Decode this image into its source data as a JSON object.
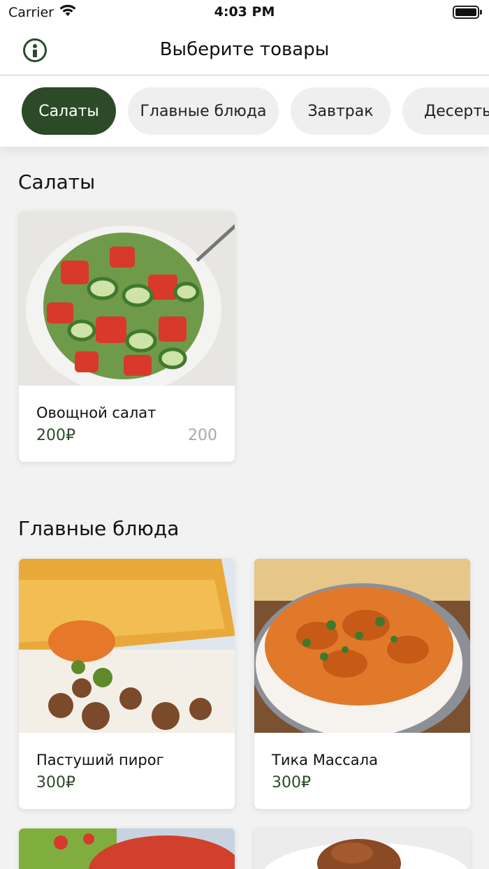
{
  "status_bar": {
    "carrier": "Carrier",
    "time": "4:03 PM"
  },
  "nav": {
    "title": "Выберите товары",
    "info_icon": "info-icon"
  },
  "categories": [
    {
      "label": "Салаты",
      "active": true
    },
    {
      "label": "Главные блюда",
      "active": false
    },
    {
      "label": "Завтрак",
      "active": false
    },
    {
      "label": "Десерты",
      "active": false
    }
  ],
  "sections": [
    {
      "title": "Салаты",
      "items": [
        {
          "name": "Овощной салат",
          "price": "200₽",
          "weight": "200"
        }
      ]
    },
    {
      "title": "Главные блюда",
      "items": [
        {
          "name": "Пастуший пирог",
          "price": "300₽"
        },
        {
          "name": "Тика Массала",
          "price": "300₽"
        }
      ]
    }
  ],
  "colors": {
    "accent": "#2c4a28",
    "chip_bg": "#efefef",
    "weight_text": "#a9a9a9"
  }
}
